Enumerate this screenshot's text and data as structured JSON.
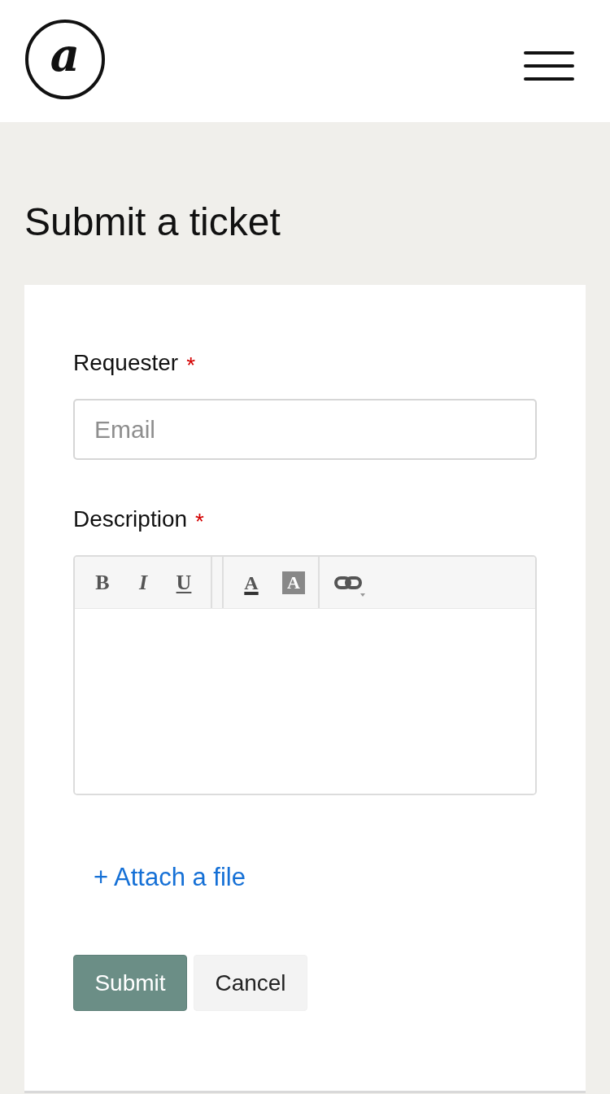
{
  "header": {
    "logo": {
      "letter": "a"
    }
  },
  "page_title": "Submit a ticket",
  "form": {
    "fields": [
      {
        "kind": "email",
        "label": "Requester",
        "required_mark": "*",
        "placeholder": "Email"
      },
      {
        "kind": "rich_text",
        "label": "Description",
        "required_mark": "*",
        "toolbar": [
          {
            "buttons": [
              {
                "kind": "bold",
                "label": "B"
              },
              {
                "kind": "italic",
                "label": "I"
              },
              {
                "kind": "underline",
                "label": "U"
              }
            ]
          },
          {
            "buttons": [
              {
                "kind": "text_color",
                "label": "A"
              },
              {
                "kind": "background_color",
                "label": "A"
              }
            ]
          },
          {
            "buttons": [
              {
                "kind": "link"
              }
            ]
          }
        ]
      }
    ],
    "attachment_link": "+ Attach a file",
    "buttons": [
      {
        "kind": "primary",
        "label": "Submit"
      },
      {
        "kind": "secondary",
        "label": "Cancel"
      }
    ]
  }
}
